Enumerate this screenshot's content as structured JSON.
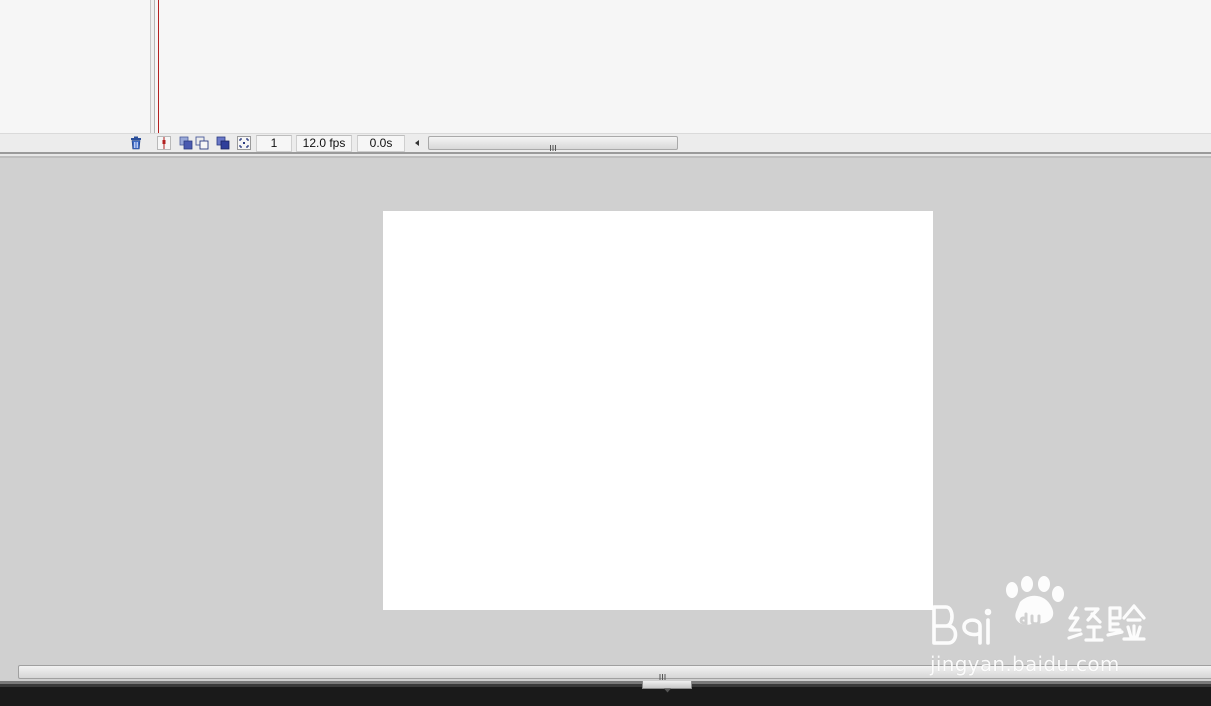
{
  "timeline": {
    "status_bar": {
      "current_frame": "1",
      "frame_rate": "12.0 fps",
      "elapsed_time": "0.0s"
    }
  },
  "icons": {
    "delete_layer": "trash-icon",
    "center_frame": "center-frame-icon",
    "onion_skin": "onion-skin-icon",
    "onion_skin_outlines": "onion-skin-outlines-icon",
    "edit_multiple_frames": "edit-multiple-frames-icon",
    "modify_onion_markers": "modify-onion-markers-icon"
  },
  "watermark": {
    "logo_text": "Baidu经验",
    "url": "jingyan.baidu.com"
  },
  "colors": {
    "playhead": "#b32121",
    "stage": "#ffffff",
    "pasteboard": "#d0d0d0",
    "panel": "#f6f6f6"
  }
}
